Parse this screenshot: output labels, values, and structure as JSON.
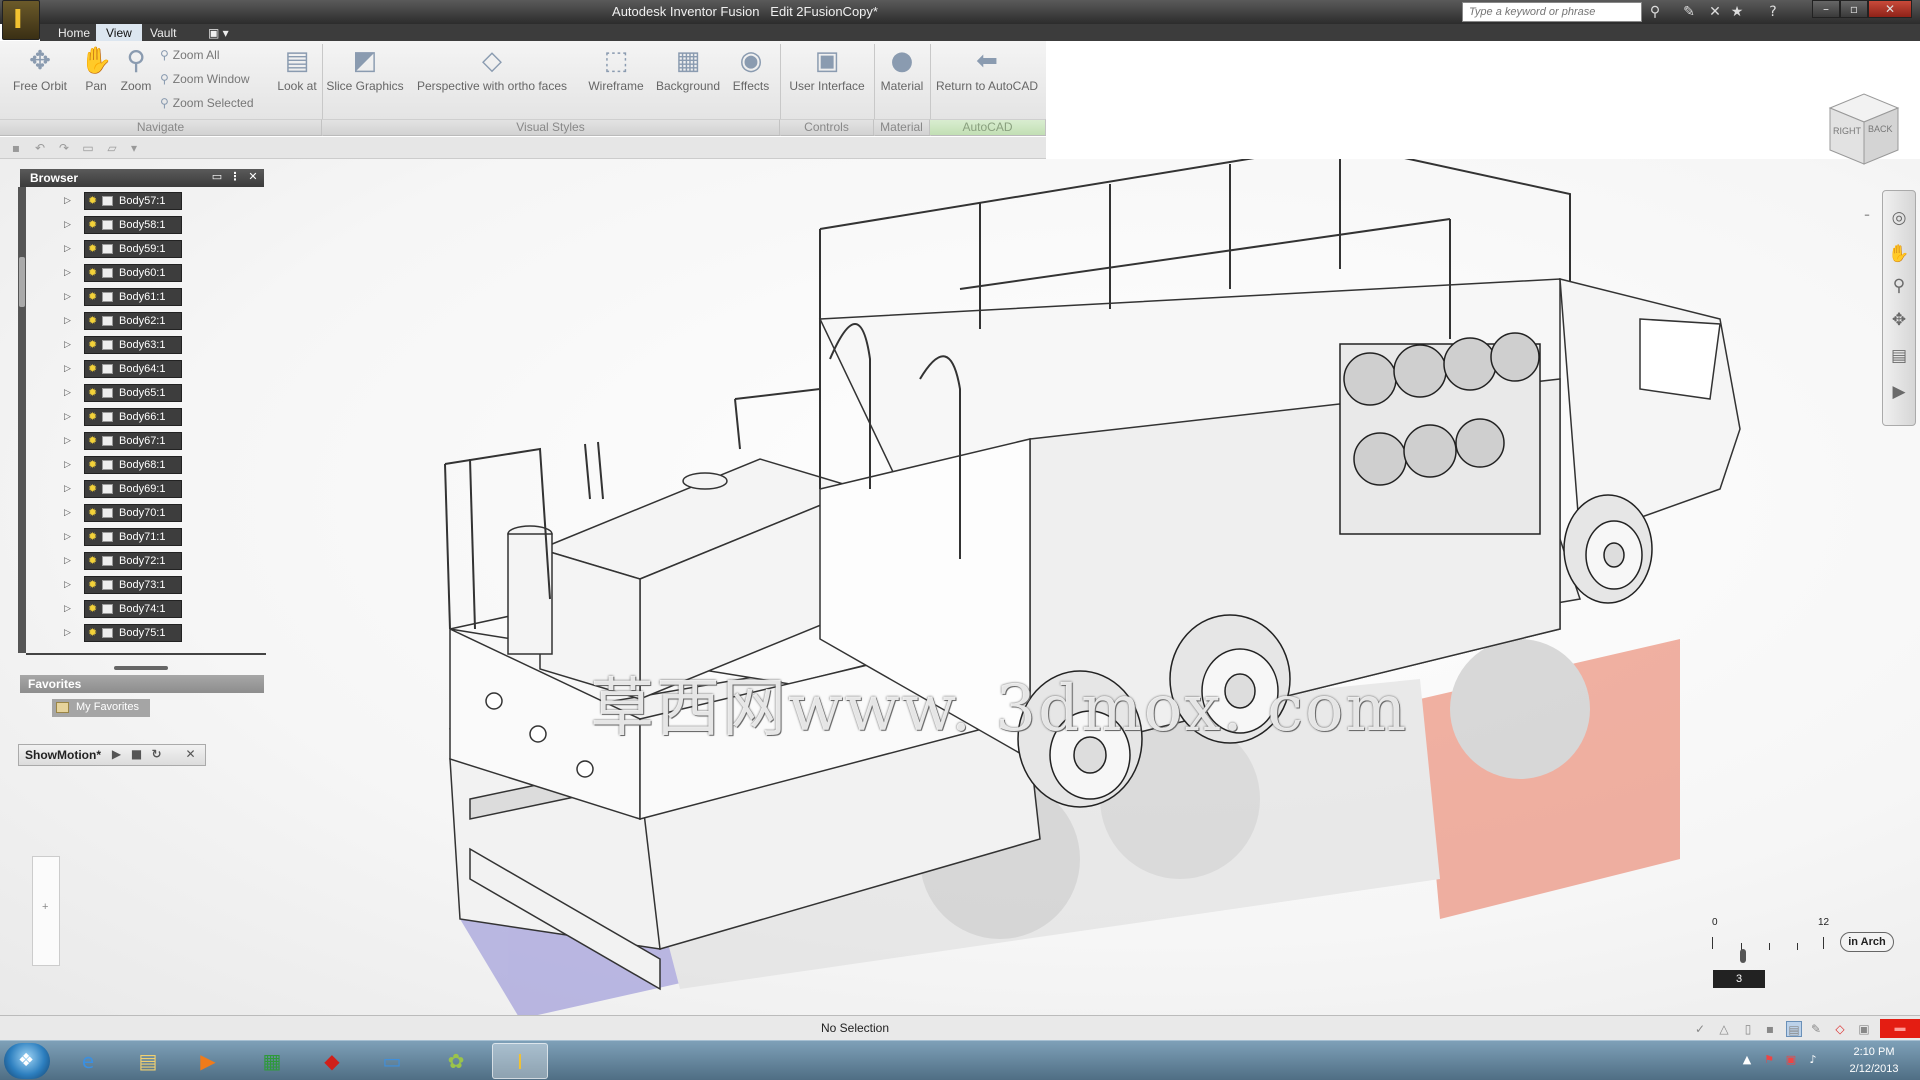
{
  "window": {
    "title": "Autodesk Inventor Fusion",
    "document": "Edit 2FusionCopy*",
    "search_placeholder": "Type a keyword or phrase"
  },
  "menu": [
    "Home",
    "View",
    "Vault"
  ],
  "menu_active": "View",
  "ribbon": {
    "navigate": {
      "free_orbit": "Free Orbit",
      "pan": "Pan",
      "zoom": "Zoom",
      "zoom_all": "Zoom All",
      "zoom_window": "Zoom Window",
      "zoom_selected": "Zoom Selected",
      "look_at": "Look at",
      "label": "Navigate"
    },
    "visual_styles": {
      "slice_graphics": "Slice Graphics",
      "perspective": "Perspective with ortho faces",
      "wireframe": "Wireframe",
      "background": "Background",
      "effects": "Effects",
      "label": "Visual Styles"
    },
    "controls": {
      "user_interface": "User Interface",
      "label": "Controls"
    },
    "material": {
      "material": "Material",
      "label": "Material"
    },
    "autocad": {
      "return": "Return to AutoCAD",
      "label": "AutoCAD"
    }
  },
  "browser": {
    "title": "Browser",
    "items": [
      "Body57:1",
      "Body58:1",
      "Body59:1",
      "Body60:1",
      "Body61:1",
      "Body62:1",
      "Body63:1",
      "Body64:1",
      "Body65:1",
      "Body66:1",
      "Body67:1",
      "Body68:1",
      "Body69:1",
      "Body70:1",
      "Body71:1",
      "Body72:1",
      "Body73:1",
      "Body74:1",
      "Body75:1"
    ]
  },
  "favorites": {
    "title": "Favorites",
    "item": "My Favorites"
  },
  "showmotion": {
    "title": "ShowMotion*"
  },
  "viewcube": {
    "face_right": "RIGHT",
    "face_back": "BACK"
  },
  "watermark": "草西网www. 3dmox. com",
  "scale": {
    "min": "0",
    "max": "12",
    "value": "3",
    "unit": "in Arch"
  },
  "status": {
    "text": "No Selection"
  },
  "taskbar": {
    "time": "2:10 PM",
    "date": "2/12/2013"
  }
}
